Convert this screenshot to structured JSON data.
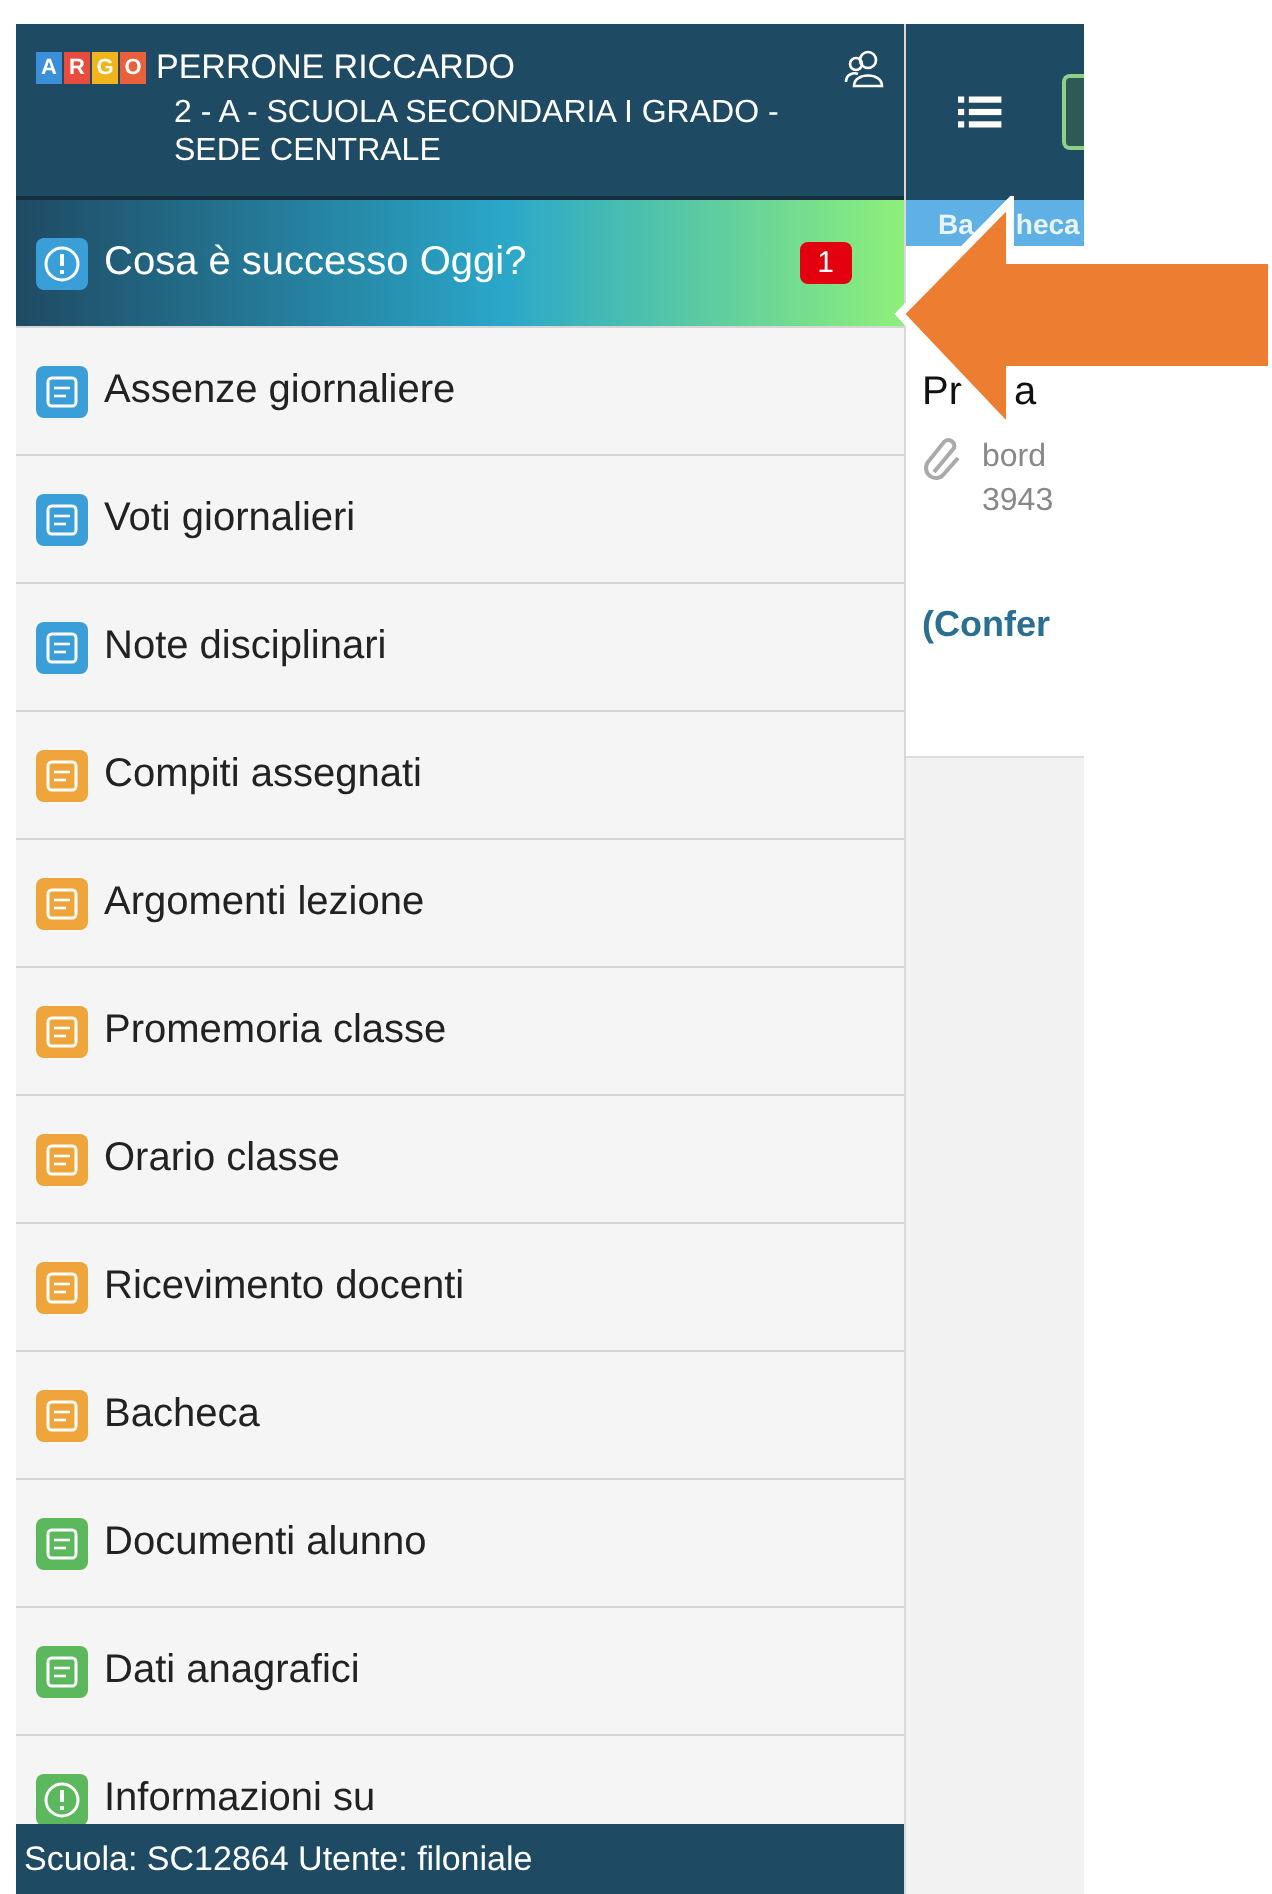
{
  "header": {
    "logo": [
      {
        "letter": "A",
        "color": "#3b8fd9"
      },
      {
        "letter": "R",
        "color": "#e84c3d"
      },
      {
        "letter": "G",
        "color": "#f1b51c"
      },
      {
        "letter": "O",
        "color": "#e8603c"
      }
    ],
    "name": "PERRONE RICCARDO",
    "class": "2 - A - SCUOLA SECONDARIA I GRADO - SEDE CENTRALE"
  },
  "menu": [
    {
      "label": "Cosa è successo Oggi?",
      "selected": true,
      "badge": "1",
      "color": "#3a9fd8"
    },
    {
      "label": "Assenze giornaliere",
      "selected": false,
      "color": "#3a9fd8"
    },
    {
      "label": "Voti giornalieri",
      "selected": false,
      "color": "#3a9fd8"
    },
    {
      "label": "Note disciplinari",
      "selected": false,
      "color": "#3a9fd8"
    },
    {
      "label": "Compiti assegnati",
      "selected": false,
      "color": "#f0a43c"
    },
    {
      "label": "Argomenti lezione",
      "selected": false,
      "color": "#f0a43c"
    },
    {
      "label": "Promemoria classe",
      "selected": false,
      "color": "#f0a43c"
    },
    {
      "label": "Orario classe",
      "selected": false,
      "color": "#f0a43c"
    },
    {
      "label": "Ricevimento docenti",
      "selected": false,
      "color": "#f0a43c"
    },
    {
      "label": "Bacheca",
      "selected": false,
      "color": "#f0a43c"
    },
    {
      "label": "Documenti alunno",
      "selected": false,
      "color": "#5cb85c"
    },
    {
      "label": "Dati anagrafici",
      "selected": false,
      "color": "#5cb85c"
    },
    {
      "label": "Informazioni su",
      "selected": false,
      "color": "#5cb85c"
    }
  ],
  "footer": "Scuola: SC12864 Utente: filoniale",
  "content": {
    "tab": [
      "Ba",
      "heca"
    ],
    "title": [
      "Pr",
      "a"
    ],
    "attachment": [
      "bord",
      "3943"
    ],
    "link": "(Confer"
  }
}
